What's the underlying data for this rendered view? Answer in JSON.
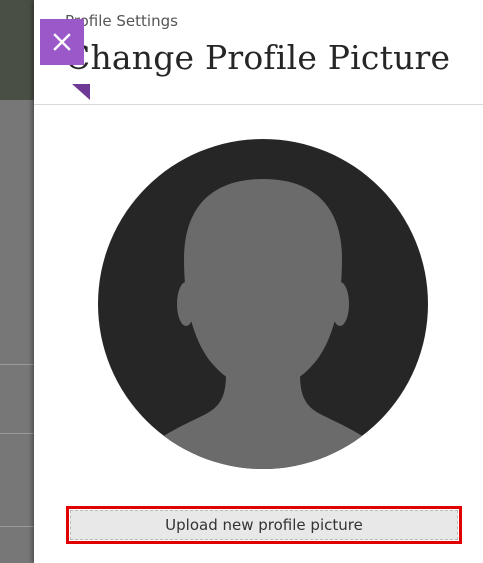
{
  "header": {
    "eyebrow": "Profile Settings",
    "title": "Change Profile Picture"
  },
  "close_button": {
    "icon": "close-icon",
    "color": "#9b58c9"
  },
  "avatar": {
    "icon": "default-user-avatar-icon",
    "background_color": "#262626",
    "silhouette_color": "#6b6b6b"
  },
  "upload": {
    "label": "Upload new profile picture",
    "highlight_color": "#e00000"
  }
}
